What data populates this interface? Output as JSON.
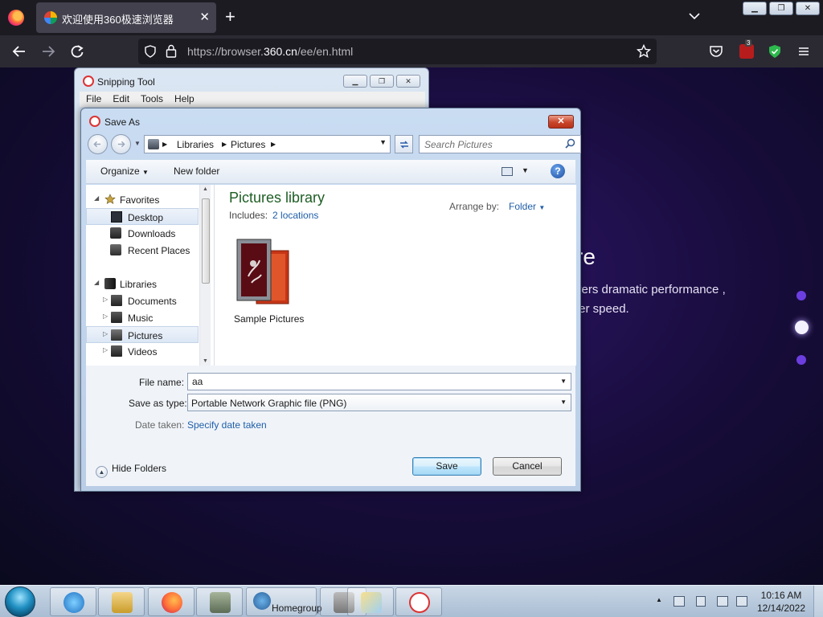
{
  "browser": {
    "tab_title": "欢迎使用360极速浏览器",
    "tab_close": "✕",
    "new_tab": "+",
    "url_prefix": "https://browser.",
    "url_host": "360.cn",
    "url_path": "/ee/en.html",
    "extension_badge": "3"
  },
  "window_buttons": {
    "minimize": "▁",
    "restore": "❐",
    "close": "✕"
  },
  "page": {
    "heading_fragment": "re",
    "line1_fragment": "vers dramatic performance ,",
    "line2_fragment": "ter speed."
  },
  "snipping_tool": {
    "title": "Snipping Tool",
    "menu": [
      "File",
      "Edit",
      "Tools",
      "Help"
    ]
  },
  "save_dialog": {
    "title": "Save As",
    "close_label": "✕",
    "breadcrumb": [
      "Libraries",
      "Pictures"
    ],
    "search_placeholder": "Search Pictures",
    "toolbar": {
      "organize": "Organize",
      "new_folder": "New folder",
      "help": "?"
    },
    "nav": {
      "favorites": "Favorites",
      "desktop": "Desktop",
      "downloads": "Downloads",
      "recent_places": "Recent Places",
      "libraries": "Libraries",
      "documents": "Documents",
      "music": "Music",
      "pictures": "Pictures",
      "videos": "Videos"
    },
    "library": {
      "title": "Pictures library",
      "includes_label": "Includes:",
      "locations_link": "2 locations",
      "arrange_label": "Arrange by:",
      "arrange_value": "Folder"
    },
    "items": [
      {
        "label": "Sample Pictures"
      }
    ],
    "form": {
      "file_name_label": "File name:",
      "file_name_value": "aa",
      "save_type_label": "Save as type:",
      "save_type_value": "Portable Network Graphic file (PNG)",
      "date_taken_label": "Date taken:",
      "date_taken_link": "Specify date taken"
    },
    "hide_folders": "Hide Folders",
    "save_button": "Save",
    "cancel_button": "Cancel"
  },
  "taskbar": {
    "homegroup_label": "Homegroup",
    "clock_time": "10:16 AM",
    "clock_date": "12/14/2022"
  },
  "colors": {
    "accent_link": "#1f5ea8",
    "library_title": "#1e5e24",
    "close_red": "#c8452b",
    "page_bg": "#170c3a"
  }
}
